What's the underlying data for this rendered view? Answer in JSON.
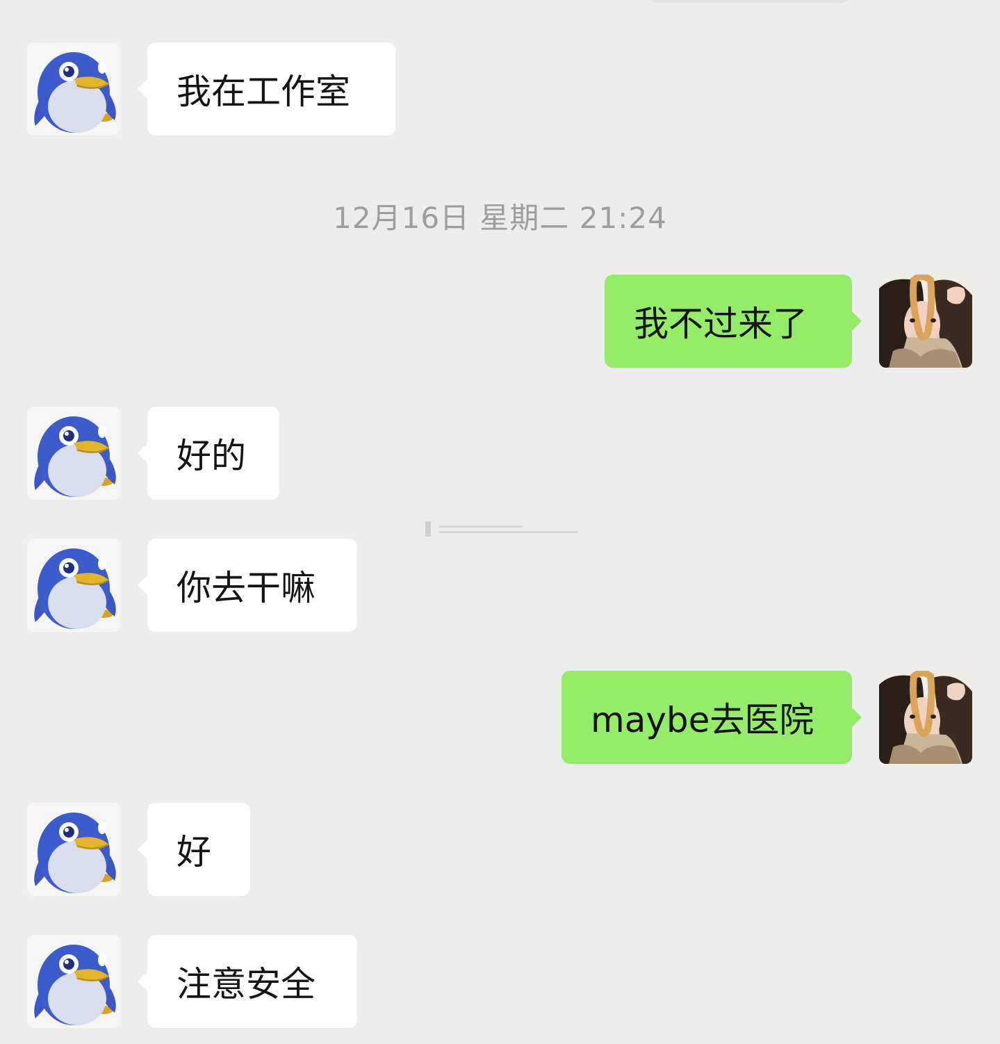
{
  "timestamp": "12月16日 星期二 21:24",
  "messages": [
    {
      "sender": "contact",
      "text": "我在工作室"
    },
    {
      "sender": "me",
      "text": "我不过来了"
    },
    {
      "sender": "contact",
      "text": "好的"
    },
    {
      "sender": "contact",
      "text": "你去干嘛"
    },
    {
      "sender": "me",
      "text": "maybe去医院"
    },
    {
      "sender": "contact",
      "text": "好"
    },
    {
      "sender": "contact",
      "text": "注意安全"
    }
  ],
  "avatars": {
    "contact": "penguin-avatar",
    "me": "selfie-avatar"
  },
  "colors": {
    "background": "#ededed",
    "incoming_bubble": "#ffffff",
    "outgoing_bubble": "#95ec69",
    "timestamp_text": "#9d9d9d"
  }
}
